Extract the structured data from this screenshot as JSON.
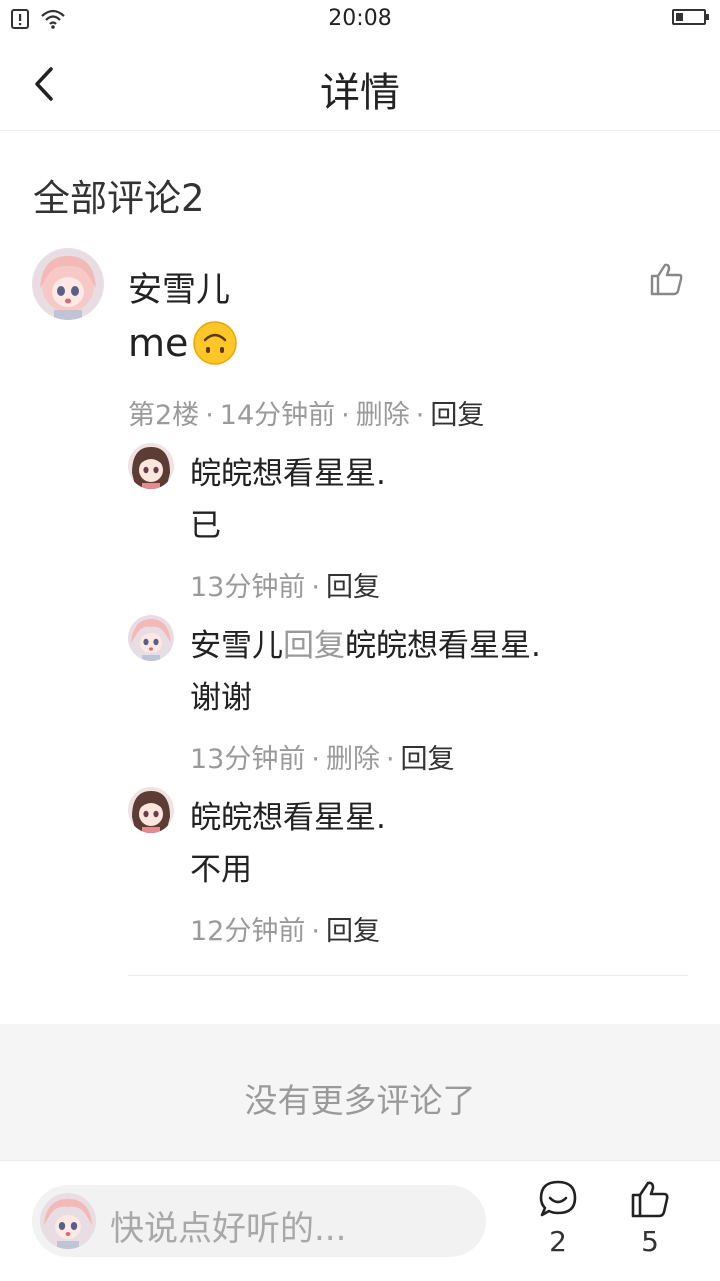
{
  "status_bar": {
    "time": "20:08"
  },
  "header": {
    "title": "详情"
  },
  "comments_title": "全部评论2",
  "main_comment": {
    "author": "安雪儿",
    "text": "me",
    "floor": "第2楼",
    "time": "14分钟前",
    "delete_label": "删除",
    "reply_label": "回复"
  },
  "replies": [
    {
      "author": "皖皖想看星星.",
      "text": "已",
      "time": "13分钟前",
      "reply_label": "回复"
    },
    {
      "author": "安雪儿",
      "reply_to_label": "回复",
      "target": "皖皖想看星星.",
      "text": "谢谢",
      "time": "13分钟前",
      "delete_label": "删除",
      "reply_label": "回复"
    },
    {
      "author": "皖皖想看星星.",
      "text": "不用",
      "time": "12分钟前",
      "reply_label": "回复"
    }
  ],
  "no_more": "没有更多评论了",
  "bottom_bar": {
    "placeholder": "快说点好听的...",
    "comment_count": "2",
    "like_count": "5"
  }
}
